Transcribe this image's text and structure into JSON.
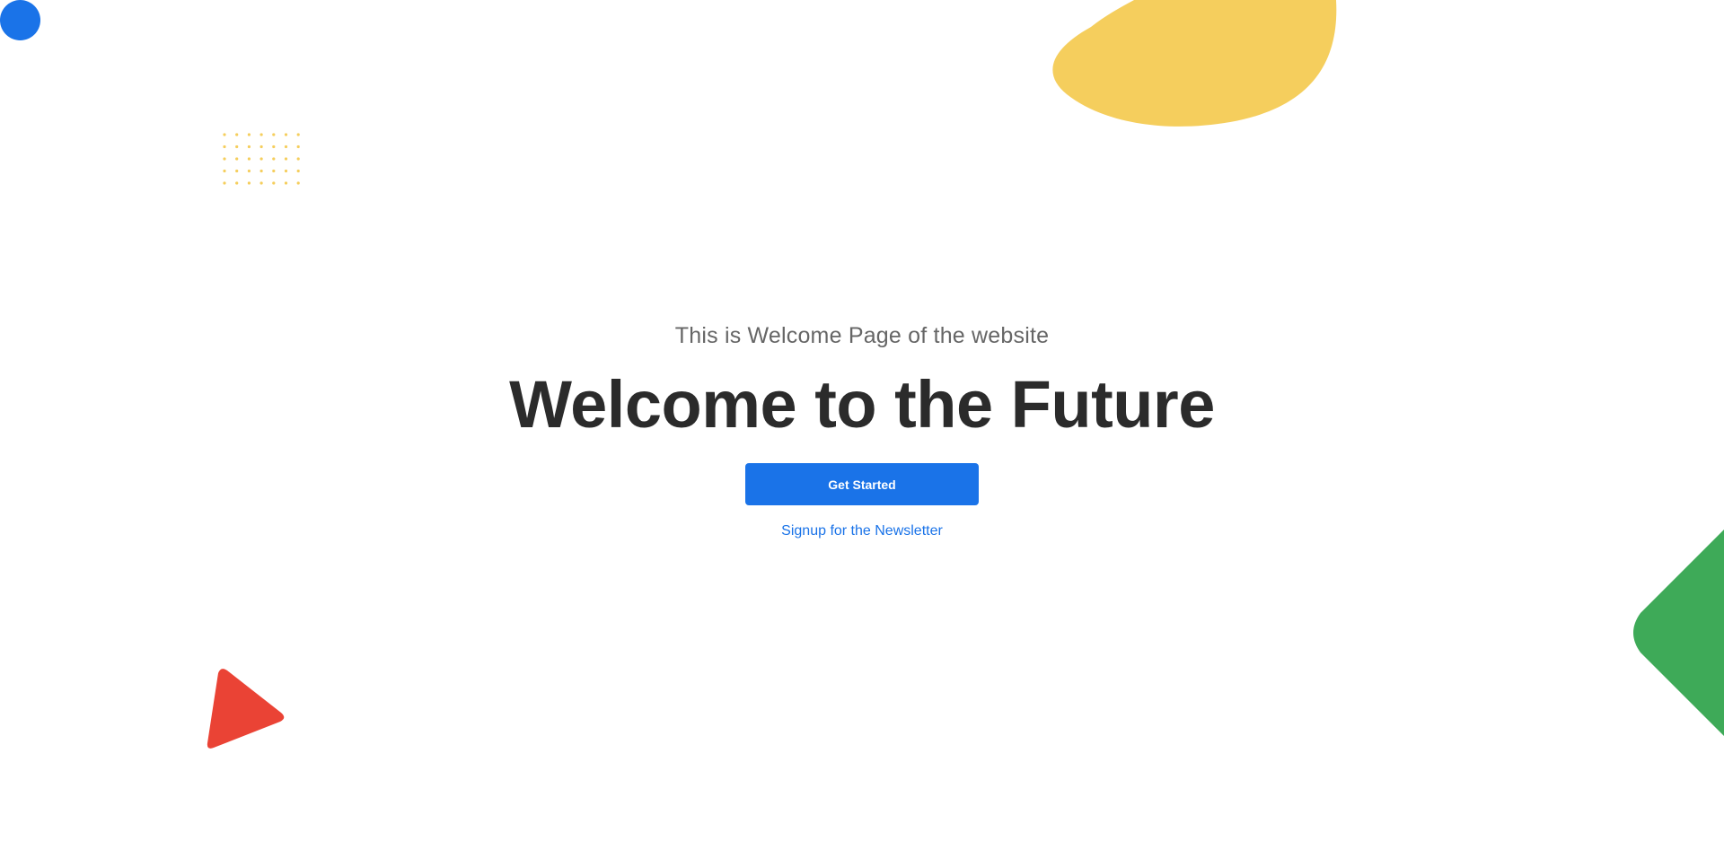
{
  "colors": {
    "blue": "#1a73e8",
    "yellow": "#f5ce5d",
    "red": "#ea4335",
    "green": "#3eaa58"
  },
  "decorations": {
    "top_left": "blue-circle",
    "top_right": "yellow-blob",
    "left_upper": "yellow-dot-grid",
    "bottom_left": "red-triangle",
    "right_edge": "green-rounded-square"
  },
  "hero": {
    "subtitle": "This is Welcome Page of the website",
    "title": "Welcome to the Future",
    "cta_label": "Get Started",
    "link_label": "Signup for the Newsletter"
  }
}
